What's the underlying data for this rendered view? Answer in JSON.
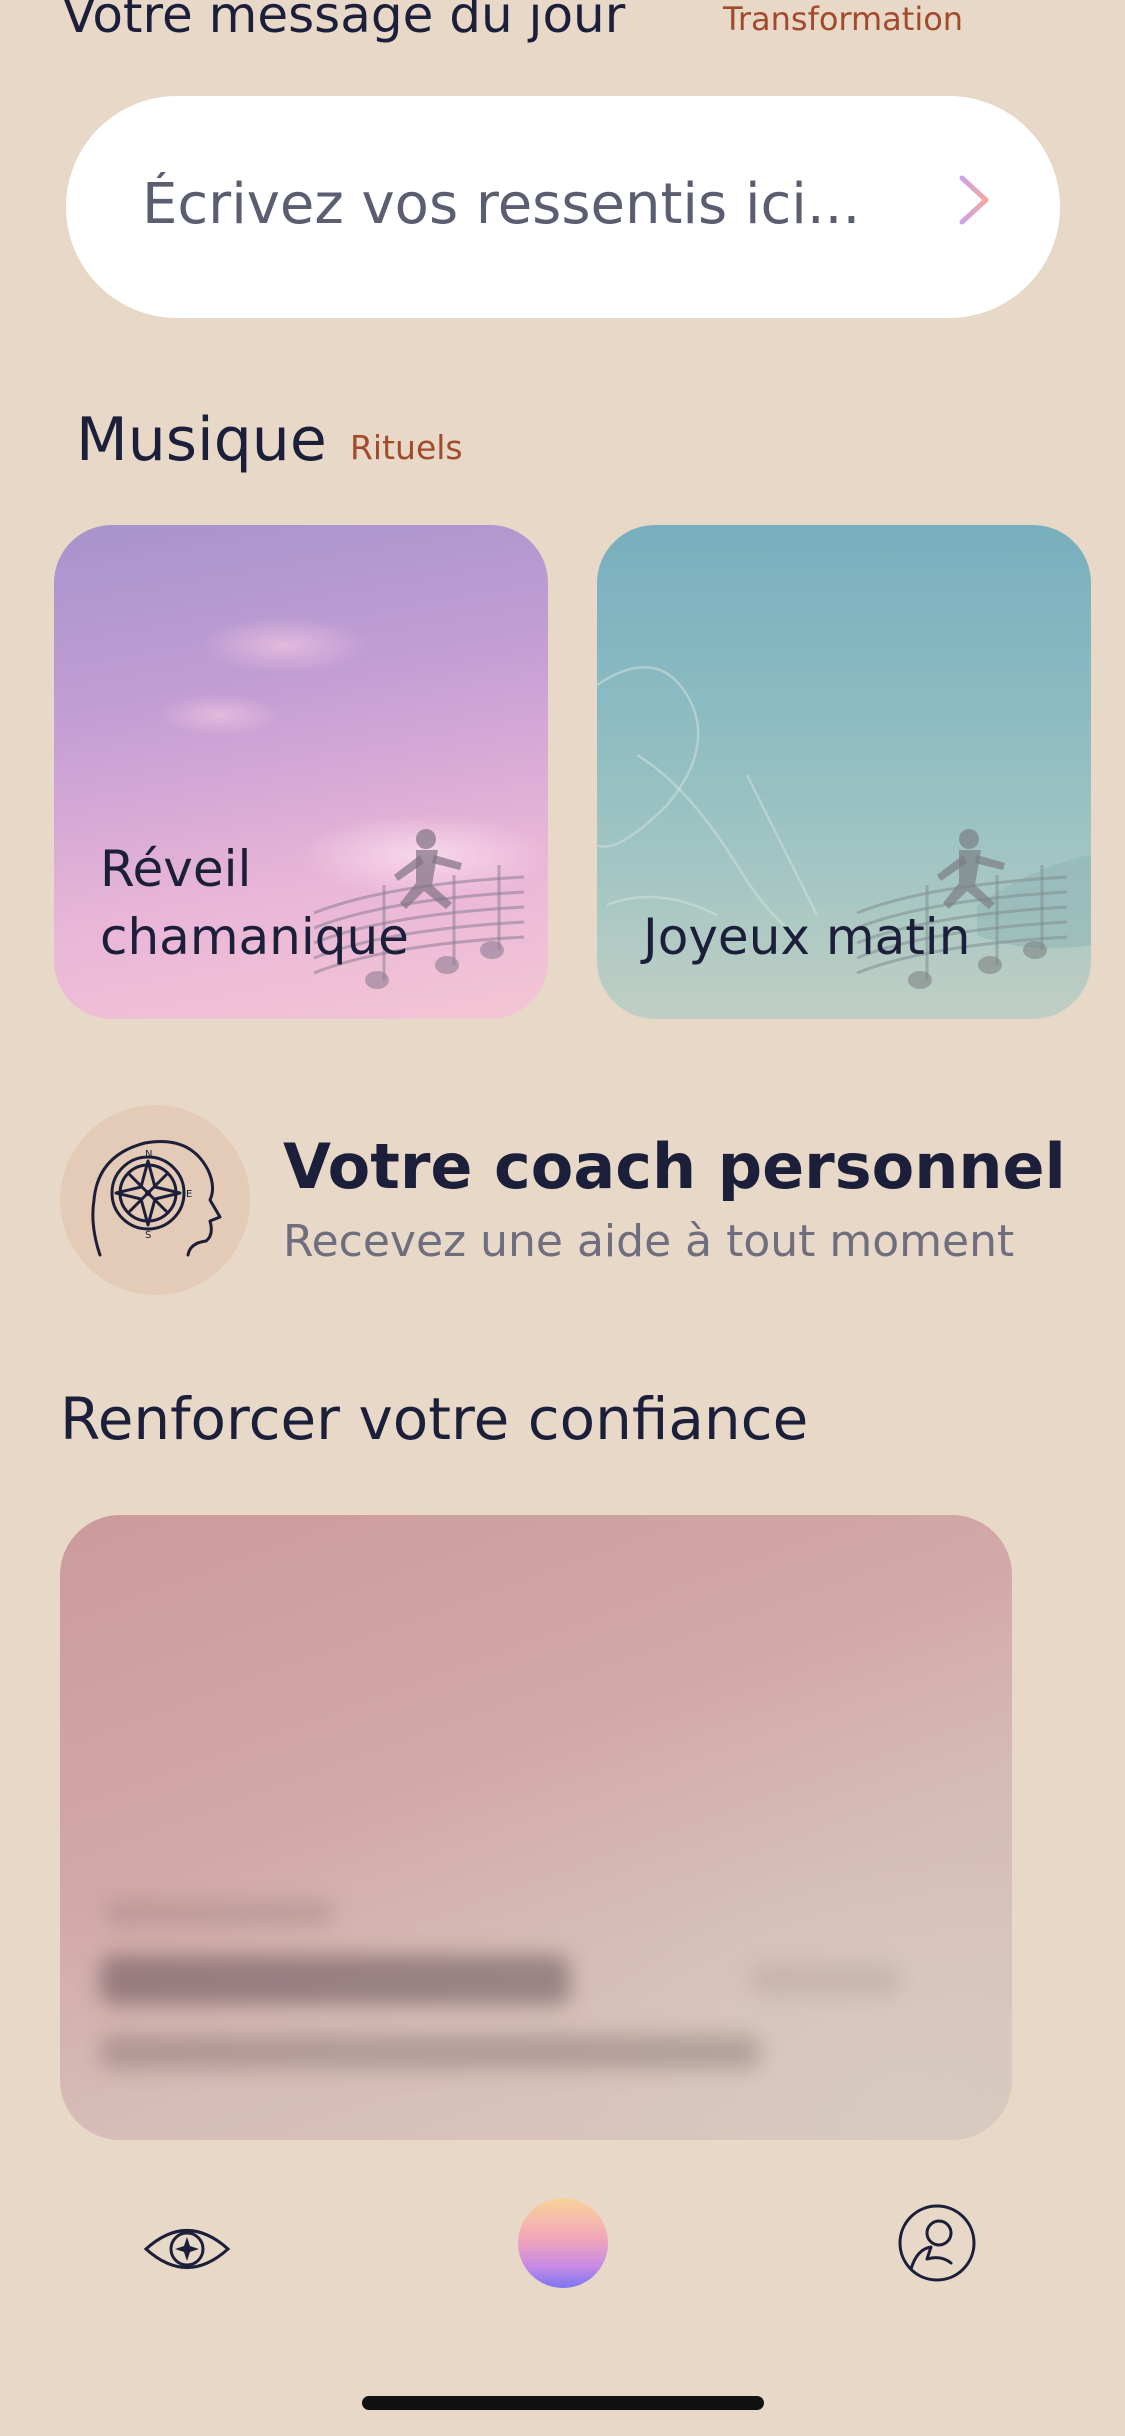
{
  "daily_message": {
    "title": "Votre message du jour",
    "tag": "Transformation",
    "input_placeholder": "Écrivez vos ressentis ici...",
    "send_icon": "arrow-right-icon"
  },
  "music": {
    "title": "Musique",
    "tag": "Rituels",
    "cards": [
      {
        "label_line1": "Réveil",
        "label_line2": "chamanique",
        "icon": "music-staff-dancer-icon"
      },
      {
        "label": "Joyeux matin",
        "icon": "music-staff-dancer-icon"
      }
    ]
  },
  "coach": {
    "title": "Votre coach personnel",
    "subtitle": "Recevez une aide à tout moment",
    "icon": "head-compass-icon"
  },
  "confidence": {
    "title": "Renforcer votre confiance"
  },
  "nav": {
    "items": [
      {
        "icon": "eye-compass-icon"
      },
      {
        "icon": "gradient-orb-icon"
      },
      {
        "icon": "profile-icon"
      }
    ]
  },
  "colors": {
    "background": "#e8d8c8",
    "accent_tag": "#a24a2a",
    "text_primary": "#1c1f3a",
    "text_secondary": "#6e6e7e"
  }
}
